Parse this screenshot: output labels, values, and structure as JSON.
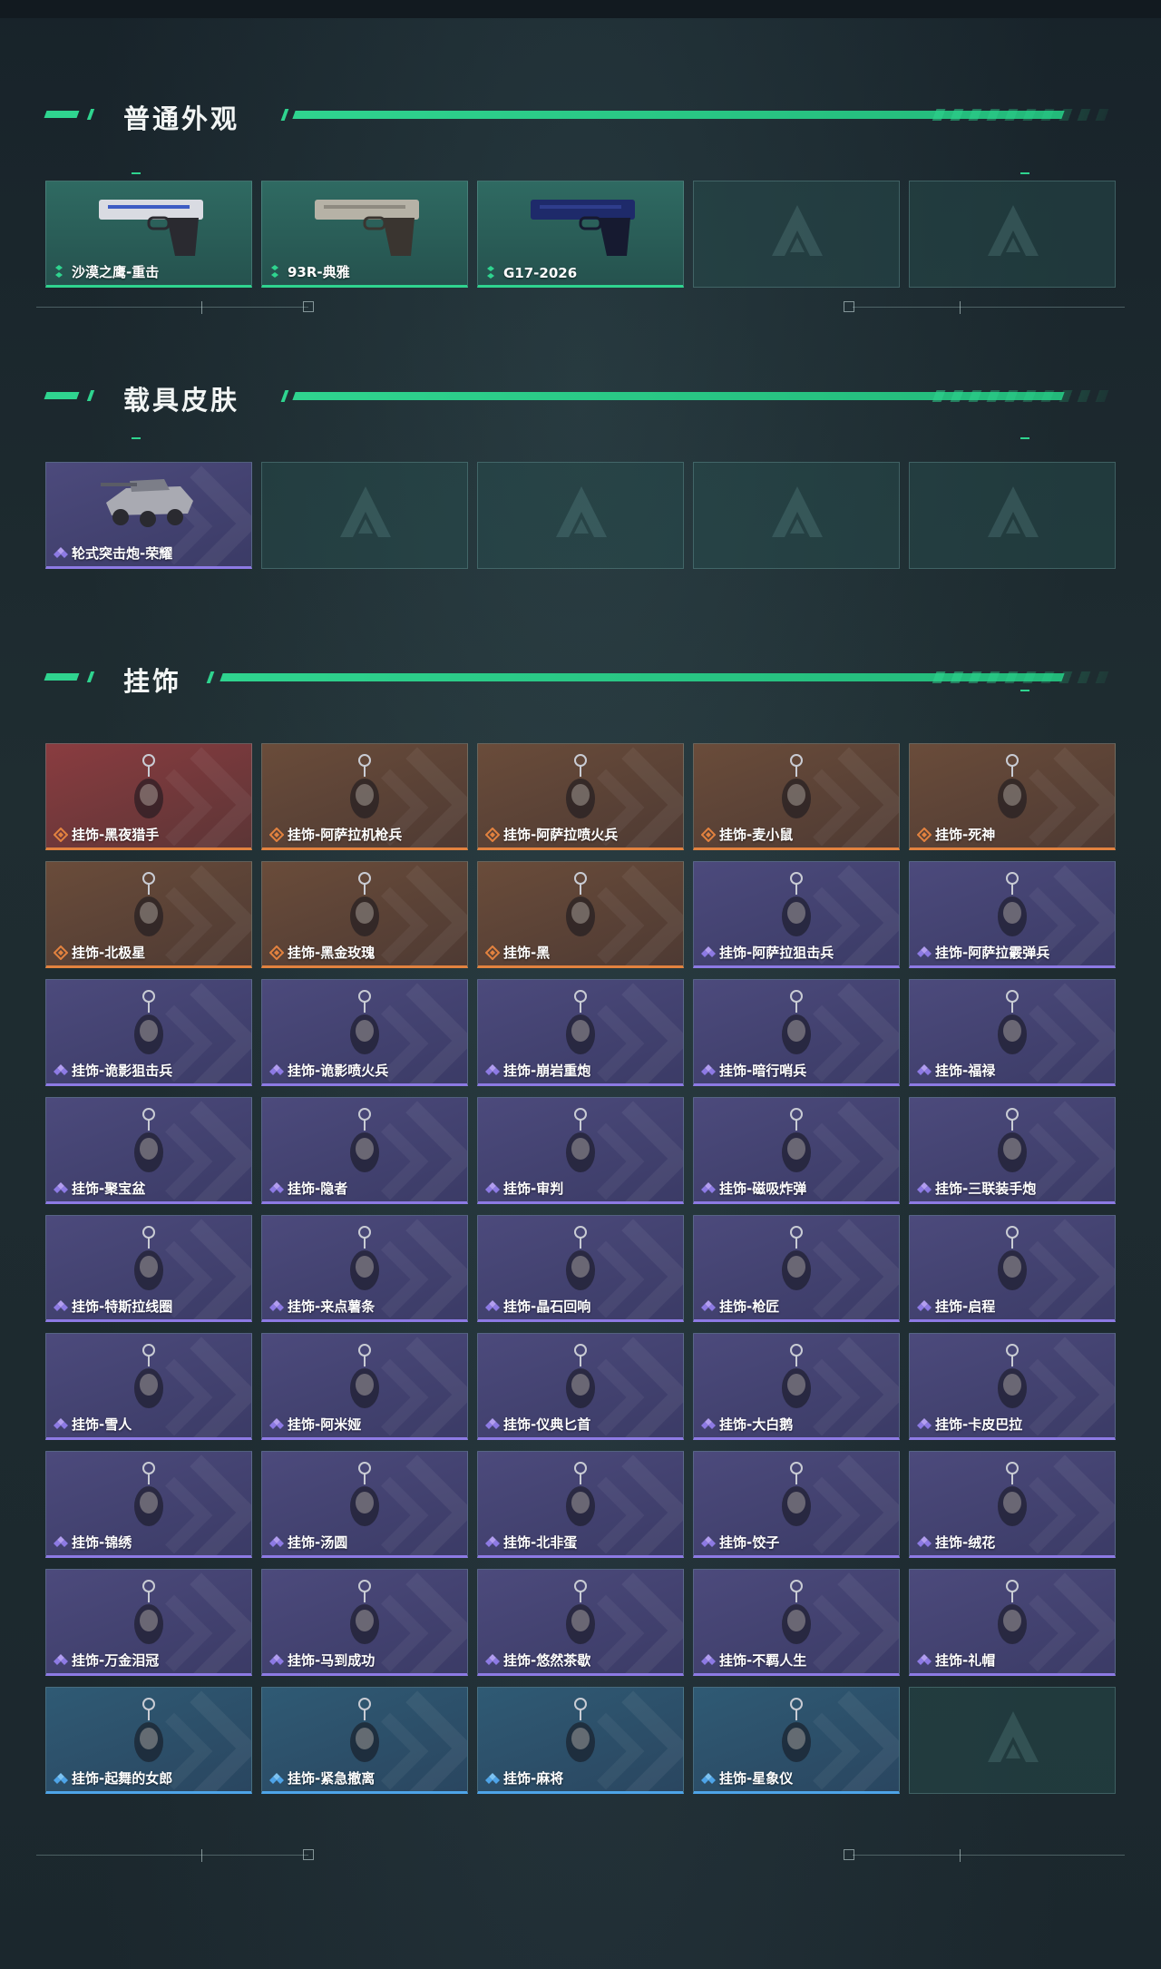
{
  "sections": {
    "weapons": {
      "title": "普通外观",
      "items": [
        {
          "label": "沙漠之鹰-重击",
          "rarity": "green",
          "icon": "pistol-deagle-icon"
        },
        {
          "label": "93R-典雅",
          "rarity": "green",
          "icon": "pistol-93r-icon"
        },
        {
          "label": "G17-2026",
          "rarity": "green",
          "icon": "pistol-g17-icon"
        },
        {
          "label": "",
          "rarity": "empty"
        },
        {
          "label": "",
          "rarity": "empty"
        }
      ]
    },
    "vehicles": {
      "title": "载具皮肤",
      "items": [
        {
          "label": "轮式突击炮-荣耀",
          "rarity": "purple",
          "icon": "armored-vehicle-icon"
        },
        {
          "label": "",
          "rarity": "empty"
        },
        {
          "label": "",
          "rarity": "empty"
        },
        {
          "label": "",
          "rarity": "empty"
        },
        {
          "label": "",
          "rarity": "empty"
        }
      ]
    },
    "charms": {
      "title": "挂饰",
      "items": [
        {
          "label": "挂饰-黑夜猎手",
          "rarity": "red"
        },
        {
          "label": "挂饰-阿萨拉机枪兵",
          "rarity": "orange"
        },
        {
          "label": "挂饰-阿萨拉喷火兵",
          "rarity": "orange"
        },
        {
          "label": "挂饰-麦小鼠",
          "rarity": "orange"
        },
        {
          "label": "挂饰-死神",
          "rarity": "orange"
        },
        {
          "label": "挂饰-北极星",
          "rarity": "orange"
        },
        {
          "label": "挂饰-黑金玫瑰",
          "rarity": "orange"
        },
        {
          "label": "挂饰-黑",
          "rarity": "orange"
        },
        {
          "label": "挂饰-阿萨拉狙击兵",
          "rarity": "purple"
        },
        {
          "label": "挂饰-阿萨拉霰弹兵",
          "rarity": "purple"
        },
        {
          "label": "挂饰-诡影狙击兵",
          "rarity": "purple"
        },
        {
          "label": "挂饰-诡影喷火兵",
          "rarity": "purple"
        },
        {
          "label": "挂饰-崩岩重炮",
          "rarity": "purple"
        },
        {
          "label": "挂饰-暗行哨兵",
          "rarity": "purple"
        },
        {
          "label": "挂饰-福禄",
          "rarity": "purple"
        },
        {
          "label": "挂饰-聚宝盆",
          "rarity": "purple"
        },
        {
          "label": "挂饰-隐者",
          "rarity": "purple"
        },
        {
          "label": "挂饰-审判",
          "rarity": "purple"
        },
        {
          "label": "挂饰-磁吸炸弹",
          "rarity": "purple"
        },
        {
          "label": "挂饰-三联装手炮",
          "rarity": "purple"
        },
        {
          "label": "挂饰-特斯拉线圈",
          "rarity": "purple"
        },
        {
          "label": "挂饰-来点薯条",
          "rarity": "purple"
        },
        {
          "label": "挂饰-晶石回响",
          "rarity": "purple"
        },
        {
          "label": "挂饰-枪匠",
          "rarity": "purple"
        },
        {
          "label": "挂饰-启程",
          "rarity": "purple"
        },
        {
          "label": "挂饰-雪人",
          "rarity": "purple"
        },
        {
          "label": "挂饰-阿米娅",
          "rarity": "purple"
        },
        {
          "label": "挂饰-仪典匕首",
          "rarity": "purple"
        },
        {
          "label": "挂饰-大白鹅",
          "rarity": "purple"
        },
        {
          "label": "挂饰-卡皮巴拉",
          "rarity": "purple"
        },
        {
          "label": "挂饰-锦绣",
          "rarity": "purple"
        },
        {
          "label": "挂饰-汤圆",
          "rarity": "purple"
        },
        {
          "label": "挂饰-北非蛋",
          "rarity": "purple"
        },
        {
          "label": "挂饰-饺子",
          "rarity": "purple"
        },
        {
          "label": "挂饰-绒花",
          "rarity": "purple"
        },
        {
          "label": "挂饰-万金泪冠",
          "rarity": "purple"
        },
        {
          "label": "挂饰-马到成功",
          "rarity": "purple"
        },
        {
          "label": "挂饰-悠然茶歇",
          "rarity": "purple"
        },
        {
          "label": "挂饰-不羁人生",
          "rarity": "purple"
        },
        {
          "label": "挂饰-礼帽",
          "rarity": "purple"
        },
        {
          "label": "挂饰-起舞的女郎",
          "rarity": "blue"
        },
        {
          "label": "挂饰-紧急撤离",
          "rarity": "blue"
        },
        {
          "label": "挂饰-麻将",
          "rarity": "blue"
        },
        {
          "label": "挂饰-星象仪",
          "rarity": "blue"
        },
        {
          "label": "",
          "rarity": "empty"
        }
      ]
    }
  },
  "colors": {
    "accent": "#2fd48f",
    "green_card": "#2f6a62",
    "purple_rarity": "#8d7ae4",
    "orange_rarity": "#e2823f",
    "blue_rarity": "#4ea4e8"
  }
}
